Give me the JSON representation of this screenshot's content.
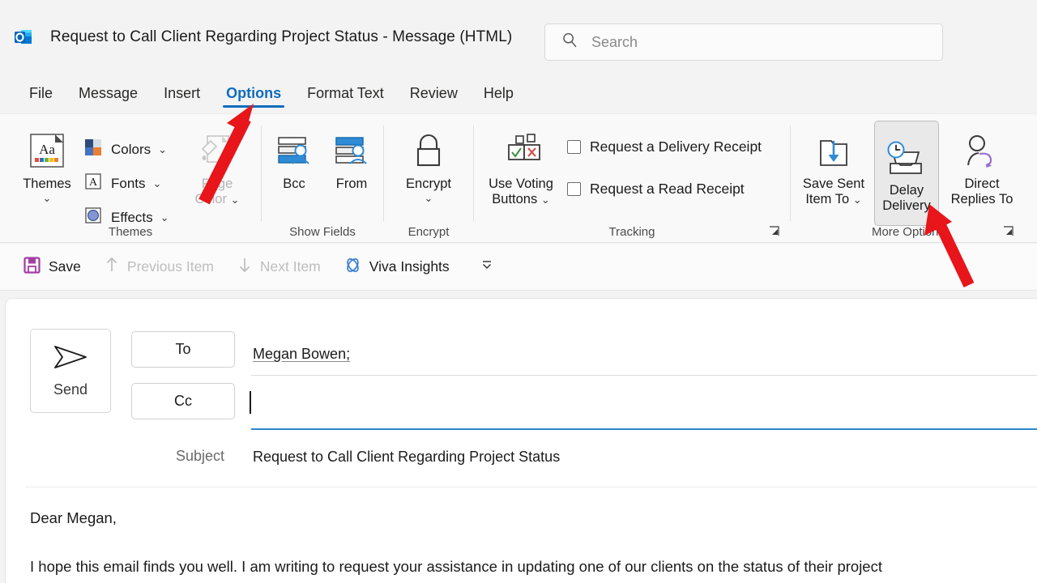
{
  "window": {
    "app_icon": "outlook-icon",
    "title": "Request to Call Client Regarding Project Status  -  Message (HTML)"
  },
  "search": {
    "icon": "search-icon",
    "placeholder": "Search",
    "value": ""
  },
  "tabs": [
    {
      "label": "File",
      "active": false
    },
    {
      "label": "Message",
      "active": false
    },
    {
      "label": "Insert",
      "active": false
    },
    {
      "label": "Options",
      "active": true
    },
    {
      "label": "Format Text",
      "active": false
    },
    {
      "label": "Review",
      "active": false
    },
    {
      "label": "Help",
      "active": false
    }
  ],
  "ribbon": {
    "groups": {
      "themes": {
        "label": "Themes",
        "themes_button": {
          "label": "Themes",
          "icon": "themes-aa-icon",
          "has_chevron": true
        },
        "colors": {
          "label": "Colors",
          "icon": "colors-swatch-icon",
          "has_chevron": true
        },
        "fonts": {
          "label": "Fonts",
          "icon": "fonts-a-icon",
          "has_chevron": true
        },
        "effects": {
          "label": "Effects",
          "icon": "effects-circle-icon",
          "has_chevron": true
        },
        "page_color": {
          "label": "Page Color",
          "icon": "page-color-icon",
          "has_chevron": true,
          "disabled": true
        }
      },
      "show_fields": {
        "label": "Show Fields",
        "bcc": {
          "label": "Bcc",
          "icon": "bcc-field-icon"
        },
        "from": {
          "label": "From",
          "icon": "from-field-icon"
        }
      },
      "encrypt": {
        "label": "Encrypt",
        "encrypt": {
          "label": "Encrypt",
          "icon": "lock-icon",
          "has_chevron": true
        }
      },
      "tracking": {
        "label": "Tracking",
        "voting": {
          "label_line1": "Use Voting",
          "label_line2": "Buttons",
          "icon": "voting-buttons-icon",
          "has_chevron": true
        },
        "delivery_receipt": {
          "label": "Request a Delivery Receipt",
          "checked": false
        },
        "read_receipt": {
          "label": "Request a Read Receipt",
          "checked": false
        },
        "dialog_launcher": "dialog-launcher-icon"
      },
      "more_options": {
        "label": "More Options",
        "save_sent": {
          "label_line1": "Save Sent",
          "label_line2": "Item To",
          "icon": "save-sent-folder-icon",
          "has_chevron": true
        },
        "delay_delivery": {
          "label_line1": "Delay",
          "label_line2": "Delivery",
          "icon": "delay-delivery-clock-icon",
          "hovered": true
        },
        "direct_replies": {
          "label_line1": "Direct",
          "label_line2": "Replies To",
          "icon": "direct-replies-person-icon"
        },
        "dialog_launcher": "dialog-launcher-icon"
      }
    }
  },
  "quick_access": {
    "save": {
      "label": "Save",
      "icon": "save-floppy-icon",
      "disabled": false
    },
    "previous_item": {
      "label": "Previous Item",
      "icon": "arrow-up-icon",
      "disabled": true
    },
    "next_item": {
      "label": "Next Item",
      "icon": "arrow-down-icon",
      "disabled": true
    },
    "viva_insights": {
      "label": "Viva Insights",
      "icon": "viva-insights-icon",
      "disabled": false
    },
    "overflow": {
      "icon": "chevron-down-icon"
    }
  },
  "compose": {
    "send_button": {
      "label": "Send",
      "icon": "send-plane-icon"
    },
    "to": {
      "button_label": "To",
      "value": "Megan Bowen;"
    },
    "cc": {
      "button_label": "Cc",
      "value": "",
      "focused": true
    },
    "subject": {
      "label": "Subject",
      "value": "Request to Call Client Regarding Project Status"
    },
    "body": {
      "greeting": "Dear Megan,",
      "paragraph": "I hope this email finds you well. I am writing to request your assistance in updating one of our clients on the status of their project"
    }
  },
  "annotations": {
    "arrow_color": "#e8151a",
    "arrows": [
      {
        "name": "arrow-pointing-to-options-tab",
        "target": "Options"
      },
      {
        "name": "arrow-pointing-to-delay-delivery",
        "target": "Delay Delivery"
      }
    ]
  },
  "colors": {
    "accent": "#0f6cbd",
    "ribbon_bg": "#f9f9f9",
    "titlebar_bg": "#f3f3f3",
    "hover_bg": "#e9e9e9"
  }
}
